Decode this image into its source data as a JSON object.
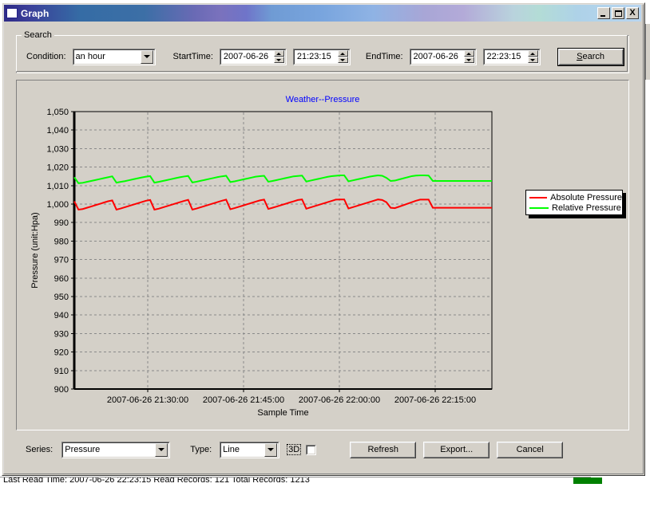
{
  "window": {
    "title": "Graph",
    "icon": "window-icon",
    "buttons": {
      "minimize": "_",
      "maximize": "□",
      "close": "X"
    }
  },
  "search": {
    "legend": "Search",
    "condition_label": "Condition:",
    "condition_value": "an hour",
    "condition_options": [
      "an hour"
    ],
    "start_time_label": "StartTime:",
    "start_date_value": "2007-06-26",
    "start_clock_value": "21:23:15",
    "end_time_label": "EndTime:",
    "end_date_value": "2007-06-26",
    "end_clock_value": "22:23:15",
    "search_button": "Search",
    "search_button_accel": "S",
    "search_button_rest": "earch"
  },
  "bottom": {
    "series_label": "Series:",
    "series_value": "Pressure",
    "series_options": [
      "Pressure"
    ],
    "type_label": "Type:",
    "type_value": "Line",
    "type_options": [
      "Line"
    ],
    "three_d_label": "3D",
    "three_d_checked": false,
    "refresh_button": "Refresh",
    "export_button": "Export...",
    "cancel_button": "Cancel"
  },
  "background_strip": {
    "text": "Last Read Time: 2007-06-26 22:23:15    Read Records: 121  Total Records: 1213",
    "status_color": "#008000"
  },
  "chart_data": {
    "type": "line",
    "title": "Weather--Pressure",
    "title_color": "#0000ff",
    "xlabel": "Sample Time",
    "ylabel": "Pressure (unit:Hpa)",
    "ylim": [
      900,
      1050
    ],
    "ytick_step": 10,
    "yticks": [
      "900",
      "910",
      "920",
      "930",
      "940",
      "950",
      "960",
      "970",
      "980",
      "990",
      "1,000",
      "1,010",
      "1,020",
      "1,030",
      "1,040",
      "1,050"
    ],
    "xticks": [
      "2007-06-26 21:30:00",
      "2007-06-26 21:45:00",
      "2007-06-26 22:00:00",
      "2007-06-26 22:15:00"
    ],
    "xtick_positions": [
      0.175,
      0.405,
      0.635,
      0.865
    ],
    "xlim_start": "2007-06-26 21:23:15",
    "xlim_end": "2007-06-26 22:23:15",
    "grid": true,
    "grid_style": "dashed",
    "grid_color": "#8a8a8a",
    "plot_background": "#d4d0c8",
    "legend_position": "outside-top-right",
    "series": [
      {
        "name": "Absolute Pressure",
        "color": "#ff0000",
        "values": [
          1001.5,
          997.0,
          997.3,
          998.0,
          998.7,
          999.4,
          1000.1,
          1000.8,
          1001.5,
          1002.0,
          997.0,
          997.6,
          998.3,
          999.0,
          999.7,
          1000.4,
          1001.1,
          1001.8,
          1002.2,
          997.0,
          997.5,
          998.2,
          998.9,
          999.6,
          1000.3,
          1001.0,
          1001.7,
          1002.3,
          997.0,
          997.6,
          998.3,
          999.0,
          999.7,
          1000.4,
          1001.1,
          1001.8,
          1002.4,
          997.2,
          997.8,
          998.5,
          999.2,
          999.9,
          1000.6,
          1001.3,
          1002.0,
          1002.4,
          997.4,
          998.0,
          998.7,
          999.4,
          1000.1,
          1000.8,
          1001.5,
          1002.2,
          1002.5,
          997.5,
          998.2,
          998.9,
          999.6,
          1000.3,
          1001.0,
          1001.7,
          1002.4,
          1002.5,
          1002.5,
          997.6,
          998.3,
          999.0,
          999.7,
          1000.4,
          1001.1,
          1001.8,
          1002.5,
          1002.2,
          1001.0,
          998.0,
          997.8,
          998.6,
          999.4,
          1000.2,
          1001.0,
          1001.8,
          1002.4,
          1002.4,
          1002.4,
          998.0,
          998.0,
          998.0,
          998.0,
          998.0,
          998.0,
          998.0,
          998.0,
          998.0,
          998.0,
          998.0,
          998.0,
          998.0,
          998.0,
          998.0
        ]
      },
      {
        "name": "Relative Pressure",
        "color": "#00ff00",
        "values": [
          1014.5,
          1011.3,
          1011.5,
          1012.0,
          1012.5,
          1013.0,
          1013.5,
          1014.0,
          1014.5,
          1015.0,
          1011.6,
          1012.0,
          1012.4,
          1012.9,
          1013.4,
          1013.9,
          1014.4,
          1014.8,
          1015.1,
          1011.6,
          1012.0,
          1012.5,
          1013.0,
          1013.5,
          1014.0,
          1014.5,
          1014.9,
          1015.2,
          1011.7,
          1012.1,
          1012.6,
          1013.1,
          1013.6,
          1014.1,
          1014.6,
          1015.0,
          1015.3,
          1011.9,
          1012.3,
          1012.8,
          1013.3,
          1013.8,
          1014.3,
          1014.8,
          1015.1,
          1015.3,
          1012.1,
          1012.5,
          1013.0,
          1013.5,
          1014.0,
          1014.5,
          1015.0,
          1015.2,
          1015.4,
          1012.2,
          1012.7,
          1013.2,
          1013.7,
          1014.2,
          1014.7,
          1015.1,
          1015.3,
          1015.5,
          1015.5,
          1012.3,
          1012.8,
          1013.3,
          1013.8,
          1014.3,
          1014.8,
          1015.2,
          1015.5,
          1015.3,
          1014.2,
          1012.5,
          1012.7,
          1013.3,
          1013.9,
          1014.5,
          1015.1,
          1015.4,
          1015.5,
          1015.5,
          1015.4,
          1012.5,
          1012.5,
          1012.5,
          1012.5,
          1012.5,
          1012.5,
          1012.5,
          1012.5,
          1012.5,
          1012.5,
          1012.5,
          1012.5,
          1012.5,
          1012.5,
          1012.5
        ]
      }
    ]
  }
}
